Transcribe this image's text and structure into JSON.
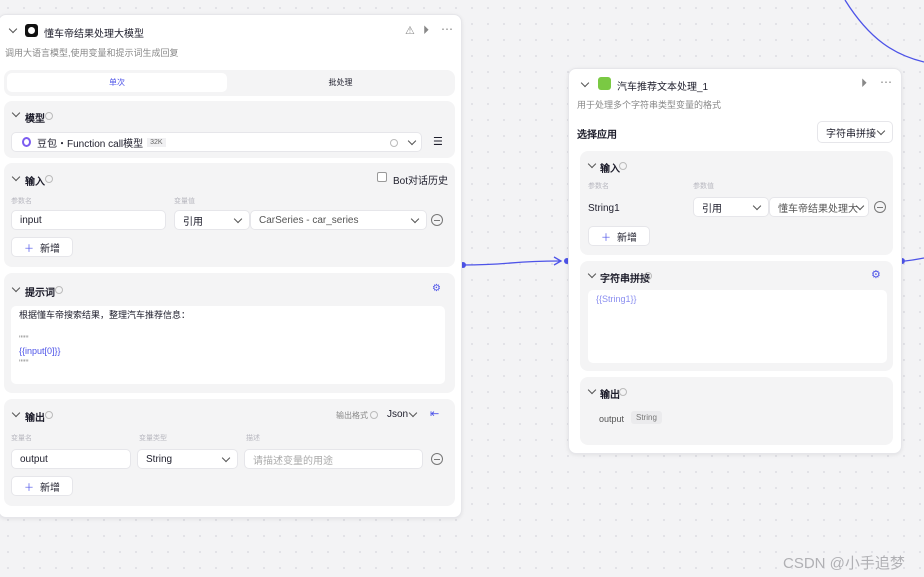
{
  "left_node": {
    "title": "懂车帝结果处理大模型",
    "description": "调用大语言模型,使用变量和提示词生成回复",
    "tabs": [
      {
        "label": "单次",
        "active": true
      },
      {
        "label": "批处理",
        "active": false
      }
    ],
    "model": {
      "title": "模型",
      "name": "豆包・Function call模型",
      "badge": "32K"
    },
    "input": {
      "title": "输入",
      "history_label": "Bot对话历史",
      "col_name": "参数名",
      "col_value": "变量值",
      "rows": [
        {
          "name": "input",
          "type": "引用",
          "value": "CarSeries - car_series"
        }
      ],
      "add_label": "新增"
    },
    "prompt": {
      "title": "提示词",
      "lines": [
        "根据懂车帝搜索结果，整理汽车推荐信息：",
        "",
        "\"\"\"",
        "{{input[0]}}",
        "\"\"\""
      ]
    },
    "output": {
      "title": "输出",
      "format_label": "输出格式",
      "format_value": "Json",
      "col_name": "变量名",
      "col_type": "变量类型",
      "col_desc": "描述",
      "rows": [
        {
          "name": "output",
          "type": "String",
          "desc_placeholder": "请描述变量的用途"
        }
      ],
      "add_label": "新增"
    }
  },
  "right_node": {
    "title": "汽车推荐文本处理_1",
    "description": "用于处理多个字符串类型变量的格式",
    "app_label": "选择应用",
    "app_value": "字符串拼接",
    "input": {
      "title": "输入",
      "col_name": "参数名",
      "col_value": "参数值",
      "rows": [
        {
          "name": "String1",
          "type": "引用",
          "value": "懂车帝结果处理大"
        }
      ],
      "add_label": "新增"
    },
    "concat": {
      "title": "字符串拼接",
      "template": "{{String1}}"
    },
    "output": {
      "title": "输出",
      "name": "output",
      "type": "String"
    }
  },
  "watermark": "CSDN @小手追梦",
  "colors": {
    "accent": "#4d53e8",
    "background": "#f3f3f5"
  }
}
